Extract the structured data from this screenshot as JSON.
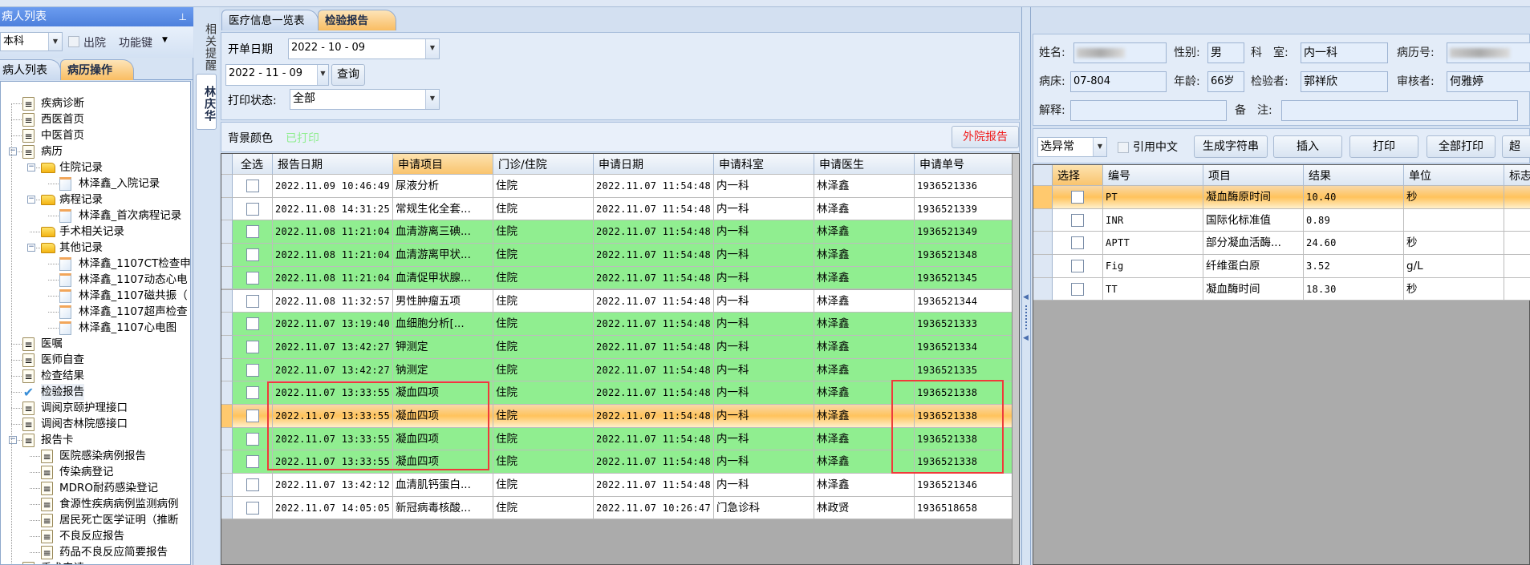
{
  "left_panel": {
    "title": "病人列表",
    "pin_icon": "pin-icon",
    "scope_select": "本科",
    "discharged_label": "出院",
    "function_key_label": "功能键",
    "tabs": [
      {
        "label": "病人列表"
      },
      {
        "label": "病历操作",
        "active": true
      }
    ],
    "tree": [
      {
        "label": "疾病诊断",
        "level": 0,
        "icon": "doc"
      },
      {
        "label": "西医首页",
        "level": 0,
        "icon": "doc"
      },
      {
        "label": "中医首页",
        "level": 0,
        "icon": "doc"
      },
      {
        "label": "病历",
        "level": 0,
        "icon": "doc",
        "expanded": true
      },
      {
        "label": "住院记录",
        "level": 1,
        "icon": "folder",
        "expanded": true
      },
      {
        "label": "林泽鑫_入院记录",
        "level": 2,
        "icon": "file"
      },
      {
        "label": "病程记录",
        "level": 1,
        "icon": "folder",
        "expanded": true
      },
      {
        "label": "林泽鑫_首次病程记录",
        "level": 2,
        "icon": "file"
      },
      {
        "label": "手术相关记录",
        "level": 1,
        "icon": "folder"
      },
      {
        "label": "其他记录",
        "level": 1,
        "icon": "folder",
        "expanded": true
      },
      {
        "label": "林泽鑫_1107CT检查申",
        "level": 2,
        "icon": "file"
      },
      {
        "label": "林泽鑫_1107动态心电",
        "level": 2,
        "icon": "file"
      },
      {
        "label": "林泽鑫_1107磁共振（",
        "level": 2,
        "icon": "file"
      },
      {
        "label": "林泽鑫_1107超声检查",
        "level": 2,
        "icon": "file"
      },
      {
        "label": "林泽鑫_1107心电图",
        "level": 2,
        "icon": "file"
      },
      {
        "label": "医嘱",
        "level": 0,
        "icon": "doc"
      },
      {
        "label": "医师自查",
        "level": 0,
        "icon": "doc"
      },
      {
        "label": "检查结果",
        "level": 0,
        "icon": "doc"
      },
      {
        "label": "检验报告",
        "level": 0,
        "icon": "check",
        "selected": true
      },
      {
        "label": "调阅京颐护理接口",
        "level": 0,
        "icon": "doc"
      },
      {
        "label": "调阅杏林院感接口",
        "level": 0,
        "icon": "doc"
      },
      {
        "label": "报告卡",
        "level": 0,
        "icon": "doc",
        "expanded": true
      },
      {
        "label": "医院感染病例报告",
        "level": 1,
        "icon": "doc"
      },
      {
        "label": "传染病登记",
        "level": 1,
        "icon": "doc"
      },
      {
        "label": "MDRO耐药感染登记",
        "level": 1,
        "icon": "doc"
      },
      {
        "label": "食源性疾病病例监测病例",
        "level": 1,
        "icon": "doc"
      },
      {
        "label": "居民死亡医学证明（推断",
        "level": 1,
        "icon": "doc"
      },
      {
        "label": "不良反应报告",
        "level": 1,
        "icon": "doc"
      },
      {
        "label": "药品不良反应简要报告",
        "level": 1,
        "icon": "doc"
      },
      {
        "label": "手术申请",
        "level": 0,
        "icon": "doc"
      }
    ]
  },
  "side_tabs": {
    "reminder": "相关提醒",
    "patient": "林庆华"
  },
  "center": {
    "tabs": [
      {
        "label": "医疗信息一览表"
      },
      {
        "label": "检验报告",
        "active": true
      }
    ],
    "filter": {
      "order_date_label": "开单日期",
      "start_date": "2022 - 10 - 09",
      "end_date": "2022 - 11 - 09",
      "query_button": "查询",
      "print_status_label": "打印状态:",
      "print_status_value": "全部"
    },
    "legend": {
      "bg_color_label": "背景颜色",
      "printed_label": "已打印",
      "printed_color": "#90ee90",
      "external_report_button": "外院报告"
    },
    "columns": [
      "全选",
      "报告日期",
      "申请项目",
      "门诊/住院",
      "申请日期",
      "申请科室",
      "申请医生",
      "申请单号"
    ],
    "rows": [
      {
        "report_date": "2022.11.09 10:46:49",
        "item": "尿液分析",
        "type": "住院",
        "apply_date": "2022.11.07 11:54:48",
        "dept": "内一科",
        "doctor": "林泽鑫",
        "apply_no": "1936521336",
        "state": "white"
      },
      {
        "report_date": "2022.11.08 14:31:25",
        "item": "常规生化全套...",
        "type": "住院",
        "apply_date": "2022.11.07 11:54:48",
        "dept": "内一科",
        "doctor": "林泽鑫",
        "apply_no": "1936521339",
        "state": "white"
      },
      {
        "report_date": "2022.11.08 11:21:04",
        "item": "血清游离三碘...",
        "type": "住院",
        "apply_date": "2022.11.07 11:54:48",
        "dept": "内一科",
        "doctor": "林泽鑫",
        "apply_no": "1936521349",
        "state": "green"
      },
      {
        "report_date": "2022.11.08 11:21:04",
        "item": "血清游离甲状...",
        "type": "住院",
        "apply_date": "2022.11.07 11:54:48",
        "dept": "内一科",
        "doctor": "林泽鑫",
        "apply_no": "1936521348",
        "state": "green"
      },
      {
        "report_date": "2022.11.08 11:21:04",
        "item": "血清促甲状腺...",
        "type": "住院",
        "apply_date": "2022.11.07 11:54:48",
        "dept": "内一科",
        "doctor": "林泽鑫",
        "apply_no": "1936521345",
        "state": "green"
      },
      {
        "report_date": "2022.11.08 11:32:57",
        "item": "男性肿瘤五项",
        "type": "住院",
        "apply_date": "2022.11.07 11:54:48",
        "dept": "内一科",
        "doctor": "林泽鑫",
        "apply_no": "1936521344",
        "state": "white"
      },
      {
        "report_date": "2022.11.07 13:19:40",
        "item": "血细胞分析[...",
        "type": "住院",
        "apply_date": "2022.11.07 11:54:48",
        "dept": "内一科",
        "doctor": "林泽鑫",
        "apply_no": "1936521333",
        "state": "green"
      },
      {
        "report_date": "2022.11.07 13:42:27",
        "item": "钾测定",
        "type": "住院",
        "apply_date": "2022.11.07 11:54:48",
        "dept": "内一科",
        "doctor": "林泽鑫",
        "apply_no": "1936521334",
        "state": "green"
      },
      {
        "report_date": "2022.11.07 13:42:27",
        "item": "钠测定",
        "type": "住院",
        "apply_date": "2022.11.07 11:54:48",
        "dept": "内一科",
        "doctor": "林泽鑫",
        "apply_no": "1936521335",
        "state": "green"
      },
      {
        "report_date": "2022.11.07 13:33:55",
        "item": "凝血四项",
        "type": "住院",
        "apply_date": "2022.11.07 11:54:48",
        "dept": "内一科",
        "doctor": "林泽鑫",
        "apply_no": "1936521338",
        "state": "green"
      },
      {
        "report_date": "2022.11.07 13:33:55",
        "item": "凝血四项",
        "type": "住院",
        "apply_date": "2022.11.07 11:54:48",
        "dept": "内一科",
        "doctor": "林泽鑫",
        "apply_no": "1936521338",
        "state": "selected"
      },
      {
        "report_date": "2022.11.07 13:33:55",
        "item": "凝血四项",
        "type": "住院",
        "apply_date": "2022.11.07 11:54:48",
        "dept": "内一科",
        "doctor": "林泽鑫",
        "apply_no": "1936521338",
        "state": "green"
      },
      {
        "report_date": "2022.11.07 13:33:55",
        "item": "凝血四项",
        "type": "住院",
        "apply_date": "2022.11.07 11:54:48",
        "dept": "内一科",
        "doctor": "林泽鑫",
        "apply_no": "1936521338",
        "state": "green"
      },
      {
        "report_date": "2022.11.07 13:42:12",
        "item": "血清肌钙蛋白...",
        "type": "住院",
        "apply_date": "2022.11.07 11:54:48",
        "dept": "内一科",
        "doctor": "林泽鑫",
        "apply_no": "1936521346",
        "state": "white"
      },
      {
        "report_date": "2022.11.07 14:05:05",
        "item": "新冠病毒核酸...",
        "type": "住院",
        "apply_date": "2022.11.07 10:26:47",
        "dept": "门急诊科",
        "doctor": "林政贤",
        "apply_no": "1936518658",
        "state": "white"
      }
    ]
  },
  "right": {
    "name_label": "姓名:",
    "gender_label": "性别:",
    "gender": "男",
    "dept_label": "科　室:",
    "dept": "内一科",
    "record_no_label": "病历号:",
    "bed_label": "病床:",
    "bed": "07-804",
    "age_label": "年龄:",
    "age": "66岁",
    "tester_label": "检验者:",
    "tester": "郭祥欣",
    "reviewer_label": "审核者:",
    "reviewer": "何雅婷",
    "explain_label": "解释:",
    "remark_label": "备　注:",
    "toolbar": {
      "filter_select": "选异常",
      "cite_chinese": "引用中文",
      "gen_string": "生成字符串",
      "insert": "插入",
      "print": "打印",
      "print_all": "全部打印",
      "more": "超"
    },
    "columns": [
      "选择",
      "编号",
      "项目",
      "结果",
      "单位",
      "标志"
    ],
    "rows": [
      {
        "code": "PT",
        "item": "凝血酶原时间",
        "result": "10.40",
        "unit": "秒",
        "selected": true
      },
      {
        "code": "INR",
        "item": "国际化标准值",
        "result": "0.89",
        "unit": ""
      },
      {
        "code": "APTT",
        "item": "部分凝血活酶...",
        "result": "24.60",
        "unit": "秒"
      },
      {
        "code": "Fig",
        "item": "纤维蛋白原",
        "result": "3.52",
        "unit": "g/L"
      },
      {
        "code": "TT",
        "item": "凝血酶时间",
        "result": "18.30",
        "unit": "秒"
      }
    ]
  }
}
